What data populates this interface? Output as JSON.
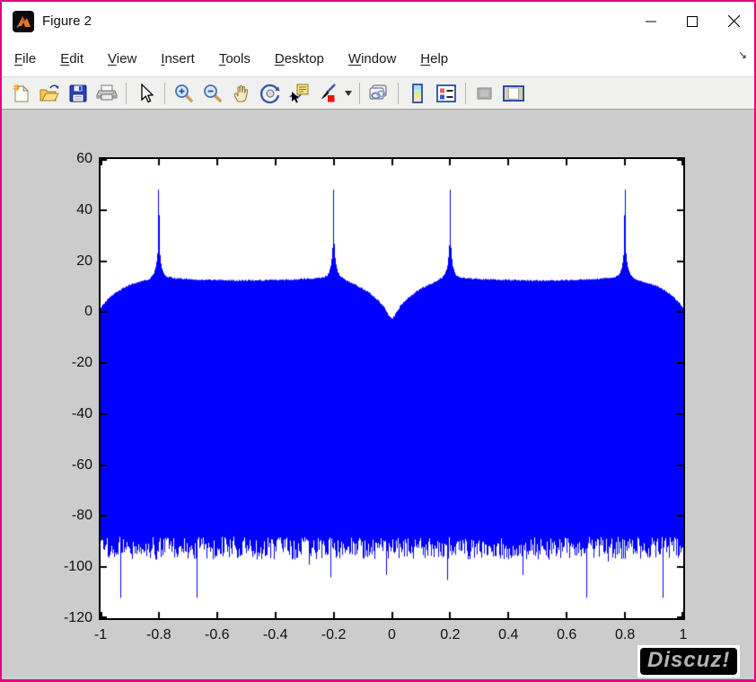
{
  "window": {
    "title": "Figure 2",
    "border_color": "#e6017e",
    "app_icon": "matlab-logo-icon",
    "controls": [
      {
        "name": "minimize"
      },
      {
        "name": "maximize"
      },
      {
        "name": "close"
      }
    ]
  },
  "menu": {
    "items": [
      {
        "label": "File",
        "mnemonic": 0
      },
      {
        "label": "Edit",
        "mnemonic": 0
      },
      {
        "label": "View",
        "mnemonic": 0
      },
      {
        "label": "Insert",
        "mnemonic": 0
      },
      {
        "label": "Tools",
        "mnemonic": 0
      },
      {
        "label": "Desktop",
        "mnemonic": 0
      },
      {
        "label": "Window",
        "mnemonic": 0
      },
      {
        "label": "Help",
        "mnemonic": 0
      }
    ],
    "overflow_arrow": "↘"
  },
  "toolbar": {
    "buttons": [
      "new-figure",
      "open-file",
      "save-figure",
      "print-figure",
      "edit-plot",
      "zoom-in",
      "zoom-out",
      "pan",
      "rotate-3d",
      "data-cursor",
      "brush-data",
      "brush-dropdown",
      "link-plot",
      "insert-colorbar",
      "insert-legend",
      "hide-plot-tools",
      "show-plot-tools"
    ],
    "disabled": [
      "hide-plot-tools"
    ]
  },
  "figure": {
    "background": "#cccccc"
  },
  "watermark": {
    "text": "Discuz!"
  },
  "chart_data": {
    "type": "area",
    "title": "",
    "xlabel": "",
    "ylabel": "",
    "xlim": [
      -1,
      1
    ],
    "ylim": [
      -120,
      60
    ],
    "grid": false,
    "box": true,
    "x_ticks": [
      -1,
      -0.8,
      -0.6,
      -0.4,
      -0.2,
      0,
      0.2,
      0.4,
      0.6,
      0.8,
      1
    ],
    "x_tick_labels": [
      "-1",
      "-0.8",
      "-0.6",
      "-0.4",
      "-0.2",
      "0",
      "0.2",
      "0.4",
      "0.6",
      "0.8",
      "1"
    ],
    "y_ticks": [
      60,
      40,
      20,
      0,
      -20,
      -40,
      -60,
      -80,
      -100,
      -120
    ],
    "y_tick_labels": [
      "60",
      "40",
      "20",
      "0",
      "-20",
      "-40",
      "-60",
      "-80",
      "-100",
      "-120"
    ],
    "line_color": "#0000ff",
    "peaks": [
      {
        "x": -0.8,
        "db": 48
      },
      {
        "x": -0.2,
        "db": 48
      },
      {
        "x": 0.2,
        "db": 48
      },
      {
        "x": 0.8,
        "db": 48
      }
    ],
    "envelope_symmetric": true,
    "envelope_points_half": [
      [
        0,
        -2.4
      ],
      [
        0.006,
        -1.8
      ],
      [
        0.012,
        -0.9
      ],
      [
        0.02,
        0.7
      ],
      [
        0.03,
        2.6
      ],
      [
        0.045,
        4.5
      ],
      [
        0.06,
        6.1
      ],
      [
        0.08,
        7.9
      ],
      [
        0.1,
        9.4
      ],
      [
        0.12,
        10.6
      ],
      [
        0.14,
        11.7
      ],
      [
        0.15,
        12.3
      ],
      [
        0.16,
        12.9
      ],
      [
        0.17,
        13.6
      ],
      [
        0.18,
        14.6
      ],
      [
        0.185,
        15.6
      ],
      [
        0.19,
        17.4
      ],
      [
        0.194,
        19.8
      ],
      [
        0.197,
        23.2
      ],
      [
        0.199,
        27.5
      ],
      [
        0.1995,
        33
      ],
      [
        0.2,
        48
      ],
      [
        0.2005,
        33
      ],
      [
        0.201,
        27.5
      ],
      [
        0.203,
        23.2
      ],
      [
        0.206,
        19.8
      ],
      [
        0.21,
        17.4
      ],
      [
        0.215,
        15.6
      ],
      [
        0.22,
        14.6
      ],
      [
        0.23,
        14.1
      ],
      [
        0.25,
        13.7
      ],
      [
        0.28,
        13.4
      ],
      [
        0.32,
        13.15
      ],
      [
        0.36,
        12.95
      ],
      [
        0.4,
        12.85
      ],
      [
        0.45,
        12.75
      ],
      [
        0.5,
        12.7
      ],
      [
        0.55,
        12.75
      ],
      [
        0.6,
        12.85
      ],
      [
        0.64,
        12.95
      ],
      [
        0.68,
        13.1
      ],
      [
        0.72,
        13.4
      ],
      [
        0.75,
        13.7
      ],
      [
        0.77,
        14.1
      ],
      [
        0.78,
        14.6
      ],
      [
        0.785,
        15.6
      ],
      [
        0.79,
        17.4
      ],
      [
        0.794,
        19.8
      ],
      [
        0.797,
        23.2
      ],
      [
        0.799,
        27.5
      ],
      [
        0.7995,
        33
      ],
      [
        0.8,
        48
      ],
      [
        0.8005,
        33
      ],
      [
        0.801,
        27.5
      ],
      [
        0.803,
        23.2
      ],
      [
        0.806,
        19.8
      ],
      [
        0.81,
        17.4
      ],
      [
        0.815,
        15.6
      ],
      [
        0.82,
        14.6
      ],
      [
        0.83,
        13.4
      ],
      [
        0.84,
        12.8
      ],
      [
        0.86,
        12.2
      ],
      [
        0.88,
        11.6
      ],
      [
        0.9,
        10.9
      ],
      [
        0.92,
        9.8
      ],
      [
        0.94,
        8.4
      ],
      [
        0.96,
        6.8
      ],
      [
        0.98,
        4.6
      ],
      [
        0.99,
        3.2
      ],
      [
        1,
        1.5
      ]
    ],
    "noise_floor": {
      "base_db": -88,
      "jitter_db": 9,
      "seed": 1234567
    },
    "deep_notches": [
      {
        "x": -0.93,
        "db": -112
      },
      {
        "x": -0.67,
        "db": -112
      },
      {
        "x": -0.21,
        "db": -104
      },
      {
        "x": -0.02,
        "db": -103
      },
      {
        "x": 0.19,
        "db": -105
      },
      {
        "x": 0.45,
        "db": -103
      },
      {
        "x": 0.67,
        "db": -112
      },
      {
        "x": 0.93,
        "db": -112
      }
    ]
  }
}
